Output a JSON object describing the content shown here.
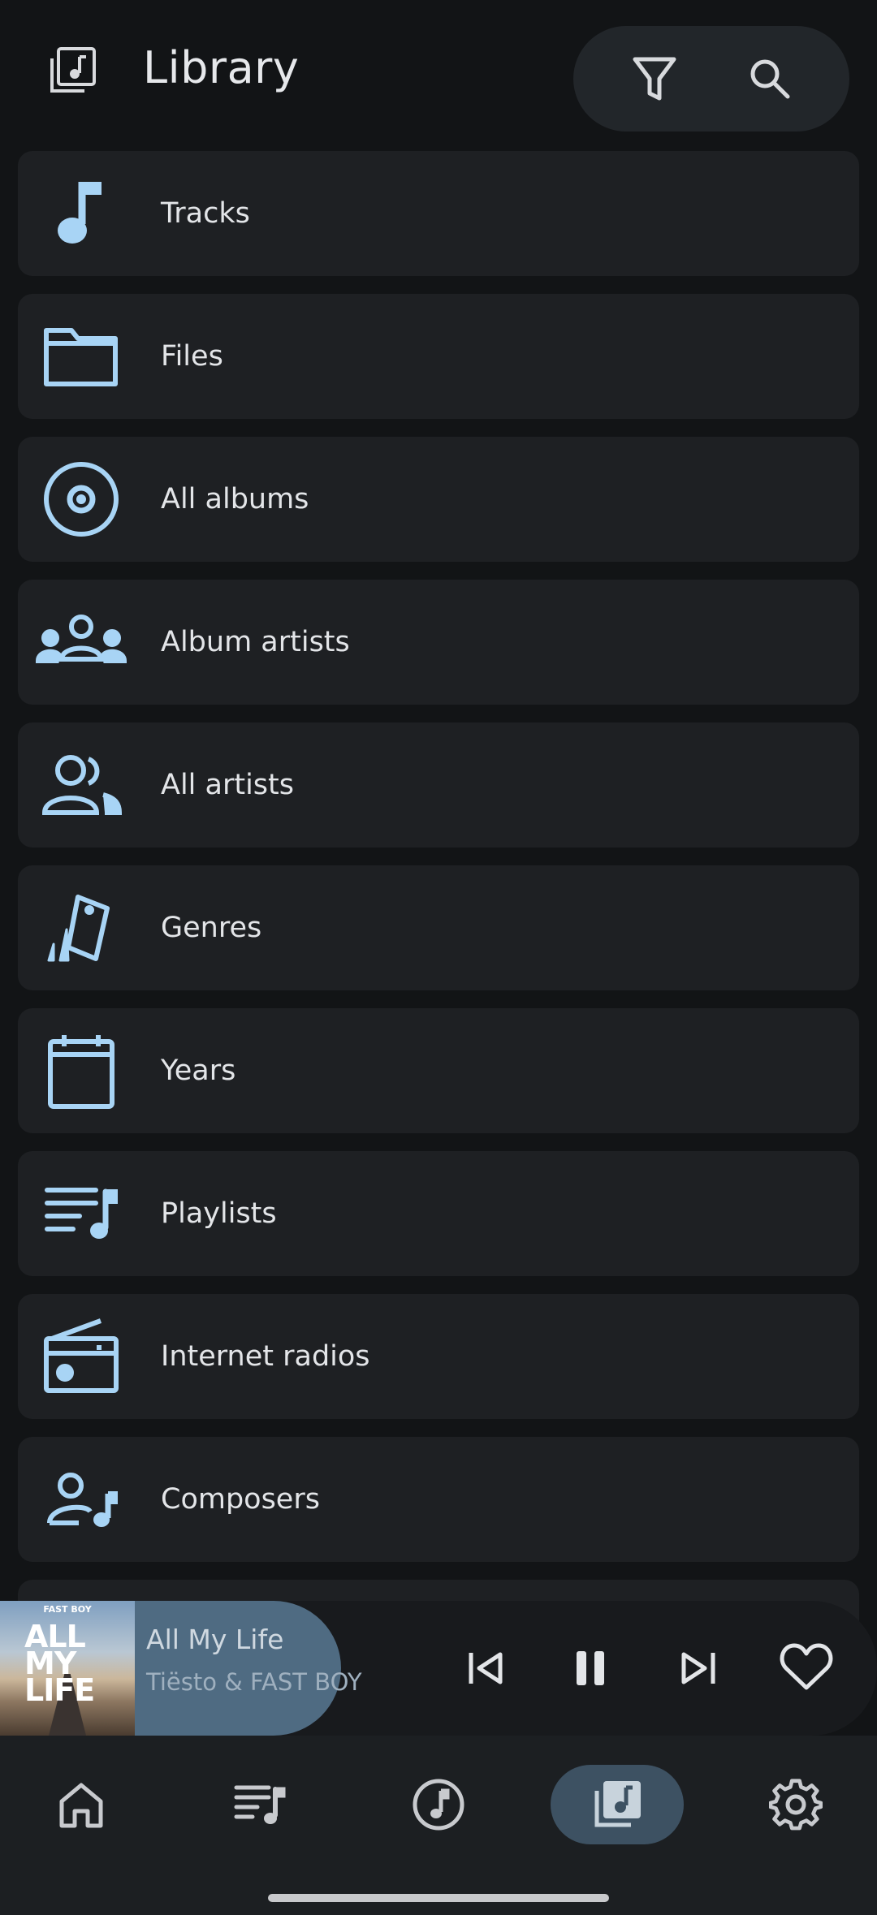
{
  "header": {
    "title": "Library",
    "icons": {
      "library": "library-music-icon",
      "filter": "filter-icon",
      "search": "search-icon"
    }
  },
  "accent_color": "#a8d4f5",
  "library_items": [
    {
      "label": "Tracks",
      "icon": "music-note-icon"
    },
    {
      "label": "Files",
      "icon": "folder-icon"
    },
    {
      "label": "All albums",
      "icon": "album-icon"
    },
    {
      "label": "Album artists",
      "icon": "groups-icon"
    },
    {
      "label": "All artists",
      "icon": "people-icon"
    },
    {
      "label": "Genres",
      "icon": "genres-icon"
    },
    {
      "label": "Years",
      "icon": "calendar-icon"
    },
    {
      "label": "Playlists",
      "icon": "playlist-icon"
    },
    {
      "label": "Internet radios",
      "icon": "radio-icon"
    },
    {
      "label": "Composers",
      "icon": "composer-icon"
    }
  ],
  "player": {
    "title": "All My Life",
    "artist": "Tiësto & FAST BOY",
    "artwork_top_text": "FAST BOY",
    "artwork_text": "ALL MY LIFE",
    "state": "playing"
  },
  "bottom_nav": [
    {
      "name": "home",
      "icon": "home-icon",
      "active": false
    },
    {
      "name": "queue",
      "icon": "queue-music-icon",
      "active": false
    },
    {
      "name": "now-playing",
      "icon": "music-disc-icon",
      "active": false
    },
    {
      "name": "library",
      "icon": "library-music-icon",
      "active": true
    },
    {
      "name": "settings",
      "icon": "settings-icon",
      "active": false
    }
  ]
}
